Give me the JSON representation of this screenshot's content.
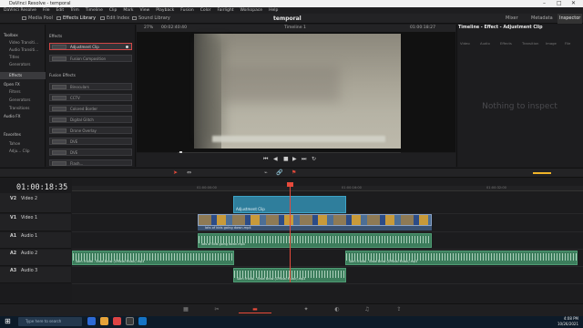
{
  "window": {
    "title": "DaVinci Resolve - temporal",
    "controls": [
      "–",
      "□",
      "✕"
    ]
  },
  "menubar": [
    "DaVinci Resolve",
    "File",
    "Edit",
    "Trim",
    "Timeline",
    "Clip",
    "Mark",
    "View",
    "Playback",
    "Fusion",
    "Color",
    "Fairlight",
    "Workspace",
    "Help"
  ],
  "toolbar": {
    "media_pool": "Media Pool",
    "effects_library": "Effects Library",
    "edit_index": "Edit Index",
    "sound_library": "Sound Library",
    "project_name": "temporal",
    "mixer": "Mixer",
    "metadata": "Metadata",
    "inspector": "Inspector"
  },
  "left_panel": {
    "toolbox": "Toolbox",
    "items": [
      "Video Transiti...",
      "Audio Transiti...",
      "Titles",
      "Generators",
      "Effects"
    ],
    "open_fx": "Open FX",
    "open_fx_items": [
      "Filters",
      "Generators",
      "Transitions"
    ],
    "audio_fx": "Audio FX",
    "favorites": "Favorites",
    "favorite_items": [
      "Tahoe",
      "Adju... Clip"
    ]
  },
  "effects_panel": {
    "section1": "Effects",
    "effects": [
      "Adjustment Clip",
      "Fusion Composition"
    ],
    "section2": "Fusion Effects",
    "fusion_effects": [
      "Binoculars",
      "CCTV",
      "Colored Border",
      "Digital Glitch",
      "Drone Overlay",
      "DVE",
      "DVE",
      "Flash..."
    ]
  },
  "viewer": {
    "zoom": "27%",
    "source_tc": "00:02:40:40",
    "timeline_name": "Timeline 1",
    "record_tc": "01:00:18:27"
  },
  "inspector": {
    "title": "Timeline - Effect - Adjustment Clip",
    "tabs": [
      "Video",
      "Audio",
      "Effects",
      "Transition",
      "Image",
      "File"
    ],
    "empty": "Nothing to inspect"
  },
  "timeline": {
    "timecode": "01:00:18:35",
    "ruler_marks": [
      "01:00:00:00",
      "01:00:16:00",
      "01:00:32:00",
      "01:00:48:00"
    ],
    "tracks": [
      {
        "id": "V2",
        "name": "Video 2"
      },
      {
        "id": "V1",
        "name": "Video 1"
      },
      {
        "id": "A1",
        "name": "Audio 1"
      },
      {
        "id": "A2",
        "name": "Audio 2"
      },
      {
        "id": "A3",
        "name": "Audio 3"
      }
    ],
    "clips": {
      "adjustment": "Adjustment Clip",
      "video": "lots of kids going down.mp4",
      "audio_video": "lots of kids going down.mp4",
      "music_a": "Sam Fraida - Brow Brow (Official Music).mp3",
      "music_b": "Sam Fraida - Brow Brow (Official Music).mp3",
      "music_c": "Sam Fraida - Brow Brow (Official Music).mp3"
    }
  },
  "taskbar": {
    "search_placeholder": "Type here to search",
    "time": "4:08 PM",
    "date": "10/26/2021"
  }
}
